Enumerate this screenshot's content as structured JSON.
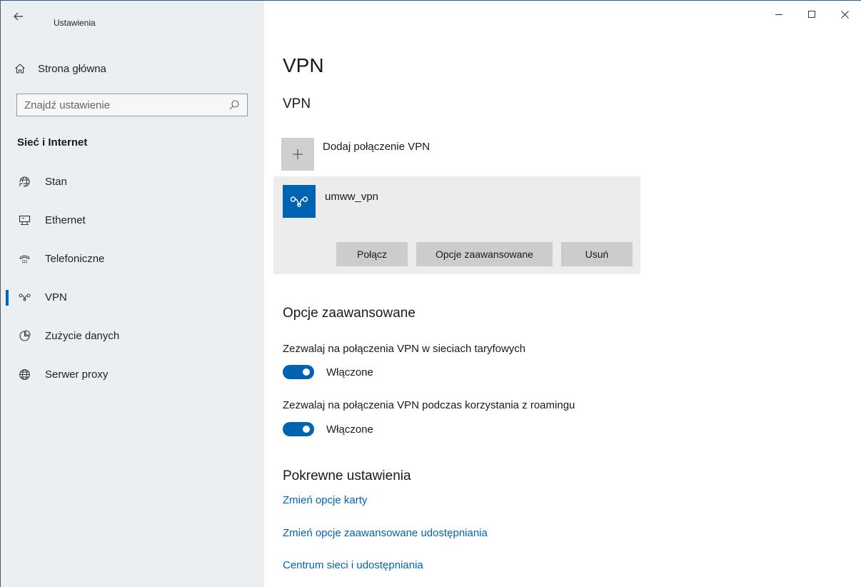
{
  "app": {
    "title": "Ustawienia"
  },
  "window_controls": {
    "minimize": "—",
    "maximize": "☐",
    "close": "✕"
  },
  "sidebar": {
    "home_label": "Strona główna",
    "search": {
      "placeholder": "Znajdź ustawienie"
    },
    "section_title": "Sieć i Internet",
    "items": [
      {
        "label": "Stan",
        "icon": "globe-status-icon",
        "active": false
      },
      {
        "label": "Ethernet",
        "icon": "ethernet-icon",
        "active": false
      },
      {
        "label": "Telefoniczne",
        "icon": "dialup-icon",
        "active": false
      },
      {
        "label": "VPN",
        "icon": "vpn-icon",
        "active": true
      },
      {
        "label": "Zużycie danych",
        "icon": "data-usage-icon",
        "active": false
      },
      {
        "label": "Serwer proxy",
        "icon": "globe-icon",
        "active": false
      }
    ]
  },
  "main": {
    "page_title": "VPN",
    "vpn_section_title": "VPN",
    "add_vpn_label": "Dodaj połączenie VPN",
    "connection": {
      "name": "umww_vpn",
      "buttons": {
        "connect": "Połącz",
        "advanced": "Opcje zaawansowane",
        "remove": "Usuń"
      }
    },
    "advanced": {
      "heading": "Opcje zaawansowane",
      "settings": [
        {
          "label": "Zezwalaj na połączenia VPN w sieciach taryfowych",
          "state": "Włączone",
          "on": true
        },
        {
          "label": "Zezwalaj na połączenia VPN podczas korzystania z roamingu",
          "state": "Włączone",
          "on": true
        }
      ]
    },
    "related": {
      "heading": "Pokrewne ustawienia",
      "links": [
        "Zmień opcje karty",
        "Zmień opcje zaawansowane udostępniania",
        "Centrum sieci i udostępniania"
      ]
    }
  },
  "colors": {
    "accent": "#0063b1",
    "sidebar_bg": "#eceff1",
    "card_bg": "#ececec",
    "button_bg": "#cccccc"
  }
}
